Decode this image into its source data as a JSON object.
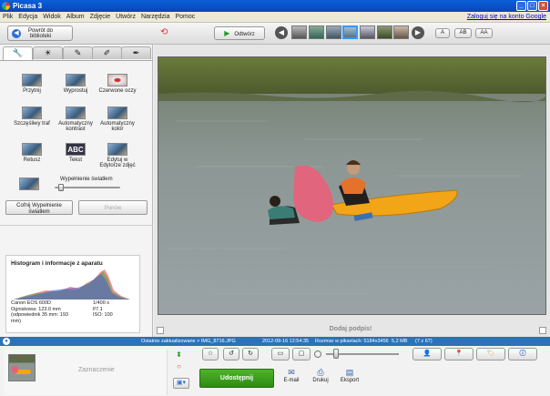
{
  "window": {
    "title": "Picasa 3"
  },
  "menu": {
    "items": [
      "Plik",
      "Edycja",
      "Widok",
      "Album",
      "Zdjęcie",
      "Utwórz",
      "Narzędzia",
      "Pomoc"
    ],
    "signin": "Zaloguj się na konto Google"
  },
  "toolbar": {
    "back_label_1": "Powrót do",
    "back_label_2": "biblioteki",
    "play_label": "Odtwórz",
    "size_labels": [
      "A",
      "AB",
      "AA"
    ]
  },
  "tabs": [
    "wrench-icon",
    "sun-icon",
    "brush-icon",
    "tint-icon",
    "effects-icon"
  ],
  "tools": [
    {
      "label": "Przytnij"
    },
    {
      "label": "Wyprostuj"
    },
    {
      "label": "Czerwone oczy"
    },
    {
      "label": "Szczęśliwy traf"
    },
    {
      "label": "Automatyczny kontrast"
    },
    {
      "label": "Automatyczny kolor"
    },
    {
      "label": "Retusz"
    },
    {
      "label": "Tekst"
    },
    {
      "label": "Edytuj w Edytorze zdjęć"
    }
  ],
  "fill_light": {
    "label": "Wypełnienie światłem",
    "value": 0.1
  },
  "panel_buttons": {
    "undo": "Cofnij Wypełnienie światłem",
    "redo": "Ponów"
  },
  "histogram": {
    "title": "Histogram i informacje z aparatu",
    "camera": "Canon EOS 600D",
    "focal": "Ogniskowa: 123.0 mm",
    "equiv": "(odpowiednik 35 mm: 193 mm)",
    "shutter": "1/400 s",
    "aperture": "f/7.1",
    "iso": "ISO: 100"
  },
  "caption": {
    "placeholder": "Dodaj podpis!"
  },
  "status": {
    "modified": "Ostatnio zaktualizowane > IMG_8716.JPG",
    "date": "2012-09-16 12:54:35",
    "dims": "Rozmiar w pikselach: 5184x3456",
    "size": "5,2 MB",
    "count": "(7 z 67)"
  },
  "bottom": {
    "tray_label": "Zaznaczenie",
    "share": "Udostępnij",
    "email": "E-mail",
    "print": "Drukuj",
    "export": "Eksport"
  },
  "colors": {
    "accent": "#2c72b7",
    "share_green": "#3d9a1e",
    "kayak": "#f2a516",
    "tube": "#e6627a"
  }
}
